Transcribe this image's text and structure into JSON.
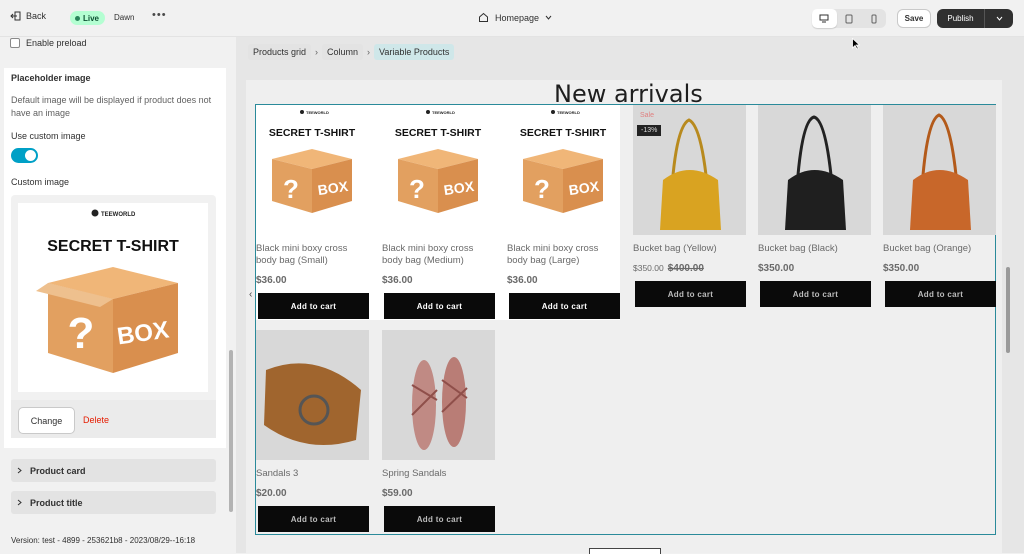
{
  "topbar": {
    "back_label": "Back",
    "live_label": "Live",
    "theme_name": "Dawn",
    "more_label": "•••",
    "page_selector": "Homepage",
    "save_label": "Save",
    "publish_label": "Publish"
  },
  "sidebar": {
    "enable_preload_label": "Enable preload",
    "placeholder": {
      "title": "Placeholder image",
      "description": "Default image will be displayed if product does not have an image",
      "use_custom_label": "Use custom image",
      "use_custom_on": true,
      "custom_image_label": "Custom image",
      "image_brand": "TEEWORLD",
      "image_headline": "SECRET T-SHIRT",
      "image_box_text": "BOX",
      "change_label": "Change",
      "delete_label": "Delete"
    },
    "accordions": [
      {
        "label": "Product card"
      },
      {
        "label": "Product title"
      }
    ],
    "version_text": "Version: test - 4899 - 253621b8 - 2023/08/29--16:18"
  },
  "preview": {
    "breadcrumbs": [
      "Products grid",
      "Column",
      "Variable Products"
    ],
    "section_title": "New arrivals",
    "products": [
      {
        "name": "Black mini boxy cross body bag (Small)",
        "price": "$36.00",
        "cta": "Add to cart",
        "placeholder": true
      },
      {
        "name": "Black mini boxy cross body bag (Medium)",
        "price": "$36.00",
        "cta": "Add to cart",
        "placeholder": true
      },
      {
        "name": "Black mini boxy cross body bag (Large)",
        "price": "$36.00",
        "cta": "Add to cart",
        "placeholder": true
      },
      {
        "name": "Bucket bag (Yellow)",
        "price": "$350.00",
        "compare_price": "$400.00",
        "sale_label": "Sale",
        "discount": "-13%",
        "cta": "Add to cart",
        "image": "yellow-bag"
      },
      {
        "name": "Bucket bag (Black)",
        "price": "$350.00",
        "cta": "Add to cart",
        "image": "black-bag"
      },
      {
        "name": "Bucket bag (Orange)",
        "price": "$350.00",
        "cta": "Add to cart",
        "image": "orange-bag"
      },
      {
        "name": "Sandals 3",
        "price": "$20.00",
        "cta": "Add to cart",
        "image": "brown-sandal"
      },
      {
        "name": "Spring Sandals",
        "price": "$59.00",
        "cta": "Add to cart",
        "image": "pink-sandals"
      }
    ],
    "placeholder_image": {
      "brand": "TEEWORLD",
      "headline": "SECRET T-SHIRT",
      "box_text": "BOX"
    }
  },
  "colors": {
    "accent_toggle": "#00a0c6",
    "live_badge": "#b4fed2",
    "delete": "#e51c00",
    "selection_outline": "#2a8a9a"
  }
}
